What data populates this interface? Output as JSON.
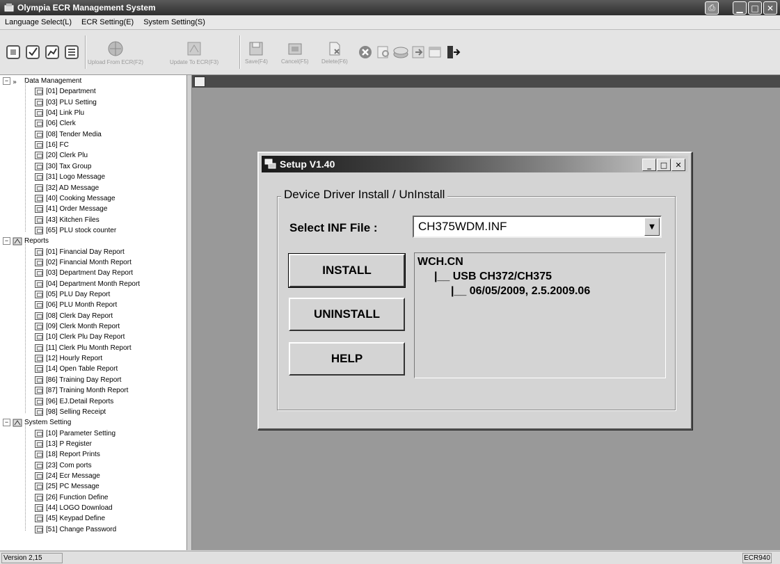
{
  "window": {
    "title": "Olympia ECR Management System"
  },
  "menu": [
    "Language Select(L)",
    "ECR Setting(E)",
    "System Setting(S)"
  ],
  "toolbar": {
    "upload_label": "Upload From ECR(F2)",
    "update_label": "Update To ECR(F3)",
    "save_label": "Save(F4)",
    "cancel_label": "Cancel(F5)",
    "delete_label": "Delete(F6)"
  },
  "tree": {
    "data_management": {
      "label": "Data Management",
      "items": [
        "[01] Department",
        "[03] PLU Setting",
        "[04] Link Plu",
        "[06] Clerk",
        "[08] Tender Media",
        "[16] FC",
        "[20] Clerk Plu",
        "[30] Tax Group",
        "[31] Logo Message",
        "[32] AD Message",
        "[40] Cooking Message",
        "[41] Order Message",
        "[43] Kitchen Files",
        "[65] PLU stock counter"
      ]
    },
    "reports": {
      "label": "Reports",
      "items": [
        "[01] Financial Day Report",
        "[02] Financial Month Report",
        "[03] Department Day Report",
        "[04] Department Month Report",
        "[05] PLU Day Report",
        "[06] PLU Month Report",
        "[08] Clerk Day Report",
        "[09] Clerk Month Report",
        "[10] Clerk Plu Day Report",
        "[11] Clerk Plu Month Report",
        "[12] Hourly Report",
        "[14] Open Table Report",
        "[86] Training Day Report",
        "[87] Training Month Report",
        "[96] EJ.Detail Reports",
        "[98] Selling Receipt"
      ]
    },
    "system_setting": {
      "label": "System Setting",
      "items": [
        "[10] Parameter Setting",
        "[13] P Register",
        "[18] Report Prints",
        "[23] Com ports",
        "[24] Ecr Message",
        "[25] PC Message",
        "[26] Function Define",
        "[44] LOGO Download",
        "[45] Keypad Define",
        "[51] Change Password"
      ]
    }
  },
  "status": {
    "version": "Version 2,15",
    "model": "ECR940"
  },
  "dialog": {
    "title": "Setup V1.40",
    "group_label": "Device Driver Install / UnInstall",
    "inf_label": "Select INF File :",
    "inf_value": "CH375WDM.INF",
    "install_label": "INSTALL",
    "uninstall_label": "UNINSTALL",
    "help_label": "HELP",
    "info_lines": [
      "WCH.CN",
      "|__ USB CH372/CH375",
      "|__ 06/05/2009, 2.5.2009.06"
    ]
  }
}
